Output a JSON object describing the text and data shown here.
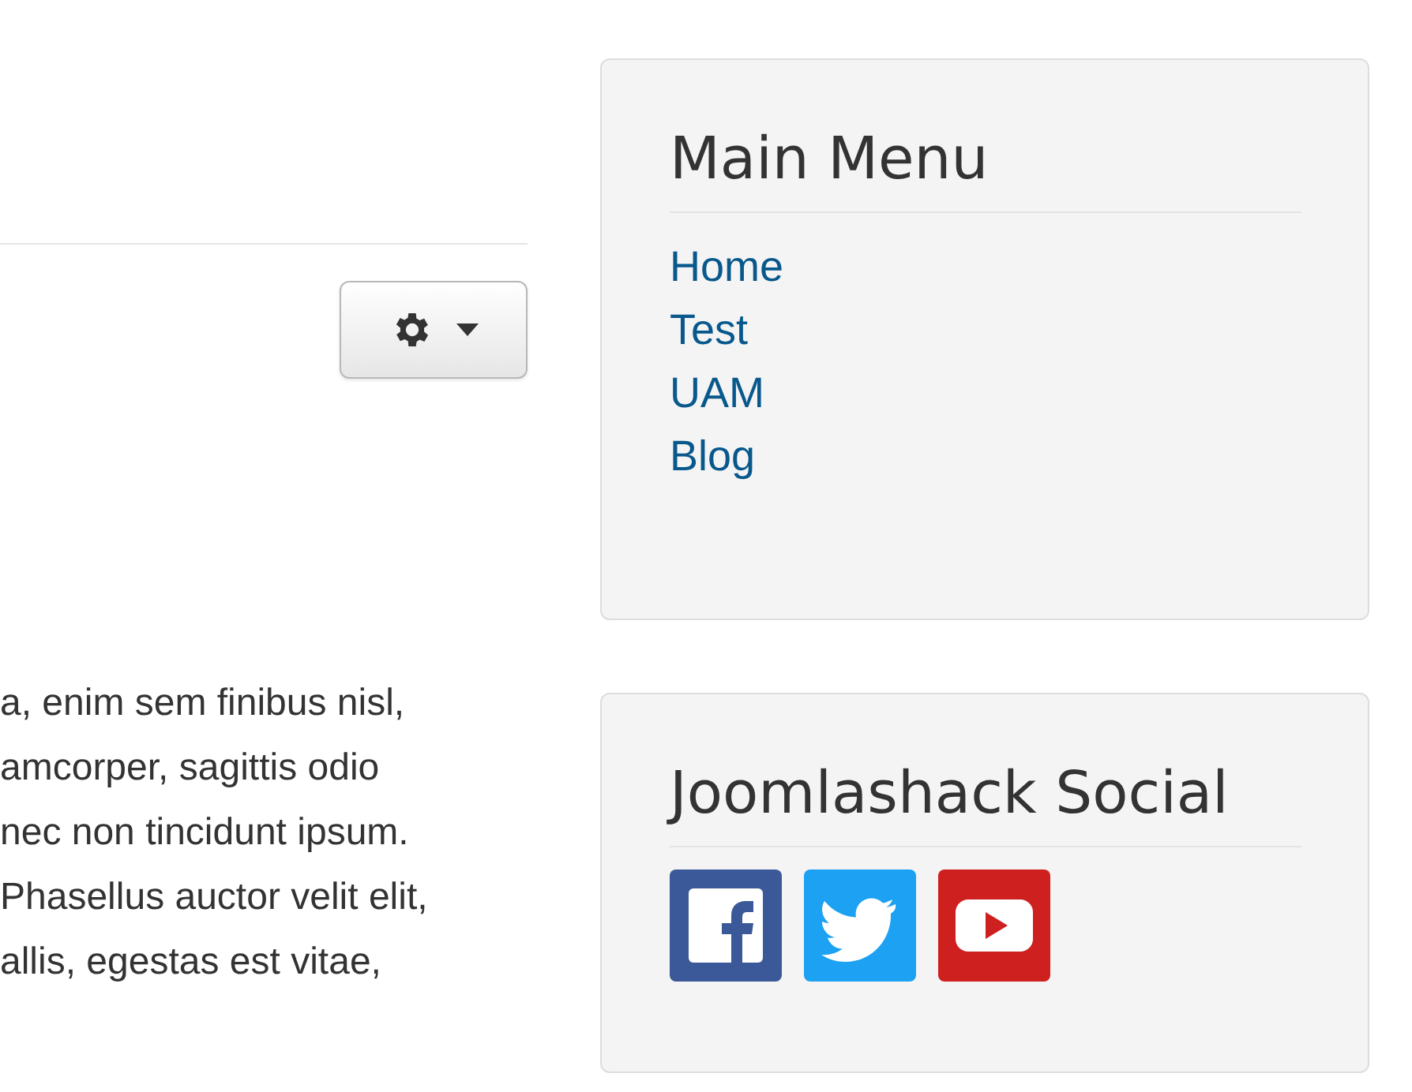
{
  "content": {
    "text_lines": [
      "a, enim sem finibus nisl,",
      "amcorper, sagittis odio",
      "nec non tincidunt ipsum.",
      "Phasellus auctor velit elit,",
      "allis, egestas est vitae,"
    ]
  },
  "main_menu": {
    "title": "Main Menu",
    "items": [
      {
        "label": "Home"
      },
      {
        "label": "Test"
      },
      {
        "label": "UAM"
      },
      {
        "label": "Blog"
      }
    ]
  },
  "social": {
    "title": "Joomlashack Social",
    "links": [
      {
        "kind": "facebook"
      },
      {
        "kind": "twitter"
      },
      {
        "kind": "youtube"
      }
    ]
  }
}
